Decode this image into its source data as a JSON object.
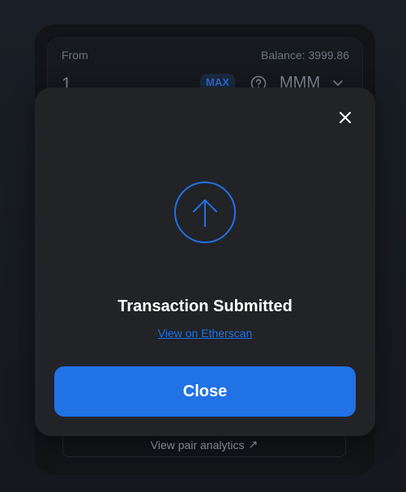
{
  "swap": {
    "from_label": "From",
    "balance": "Balance: 3999.86",
    "amount": "1",
    "max_label": "MAX",
    "token_symbol": "MMM",
    "pair_analytics_label": "View pair analytics",
    "pair_analytics_arrow": "↗"
  },
  "modal": {
    "title": "Transaction Submitted",
    "link_text": "View on Etherscan",
    "close_button_label": "Close"
  },
  "colors": {
    "accent": "#2172e5",
    "modal_bg": "#212327",
    "page_bg": "#1a1e26"
  },
  "icons": {
    "close": "close-icon",
    "status": "arrow-up-circle-icon",
    "help": "question-circle-icon",
    "token_dropdown": "chevron-down-icon",
    "external": "arrow-up-right-icon"
  }
}
